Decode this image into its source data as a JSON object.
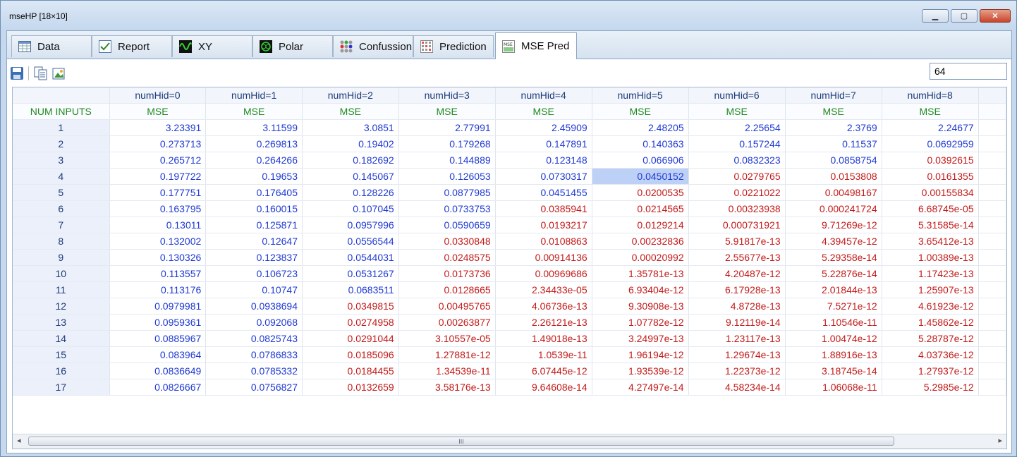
{
  "window": {
    "title": "mseHP [18×10]"
  },
  "tabs": [
    {
      "label": "Data",
      "icon": "table-icon"
    },
    {
      "label": "Report",
      "icon": "checkmark-icon"
    },
    {
      "label": "XY",
      "icon": "waveform-icon"
    },
    {
      "label": "Polar",
      "icon": "polar-icon"
    },
    {
      "label": "Confussion",
      "icon": "dots-grid-icon"
    },
    {
      "label": "Prediction",
      "icon": "grid-icon"
    },
    {
      "label": "MSE Pred",
      "icon": "mse-icon"
    }
  ],
  "active_tab": "MSE Pred",
  "toolbar": {
    "value_input": "64"
  },
  "grid": {
    "corner_header": "",
    "columns": [
      "numHid=0",
      "numHid=1",
      "numHid=2",
      "numHid=3",
      "numHid=4",
      "numHid=5",
      "numHid=6",
      "numHid=7",
      "numHid=8"
    ],
    "row_header_title": "NUM INPUTS",
    "subheader": "MSE",
    "rows": [
      {
        "label": "1",
        "values": [
          "3.23391",
          "3.11599",
          "3.0851",
          "2.77991",
          "2.45909",
          "2.48205",
          "2.25654",
          "2.3769",
          "2.24677"
        ]
      },
      {
        "label": "2",
        "values": [
          "0.273713",
          "0.269813",
          "0.19402",
          "0.179268",
          "0.147891",
          "0.140363",
          "0.157244",
          "0.11537",
          "0.0692959"
        ]
      },
      {
        "label": "3",
        "values": [
          "0.265712",
          "0.264266",
          "0.182692",
          "0.144889",
          "0.123148",
          "0.066906",
          "0.0832323",
          "0.0858754",
          "0.0392615"
        ]
      },
      {
        "label": "4",
        "values": [
          "0.197722",
          "0.19653",
          "0.145067",
          "0.126053",
          "0.0730317",
          "0.0450152",
          "0.0279765",
          "0.0153808",
          "0.0161355"
        ]
      },
      {
        "label": "5",
        "values": [
          "0.177751",
          "0.176405",
          "0.128226",
          "0.0877985",
          "0.0451455",
          "0.0200535",
          "0.0221022",
          "0.00498167",
          "0.00155834"
        ]
      },
      {
        "label": "6",
        "values": [
          "0.163795",
          "0.160015",
          "0.107045",
          "0.0733753",
          "0.0385941",
          "0.0214565",
          "0.00323938",
          "0.000241724",
          "6.68745e-05"
        ]
      },
      {
        "label": "7",
        "values": [
          "0.13011",
          "0.125871",
          "0.0957996",
          "0.0590659",
          "0.0193217",
          "0.0129214",
          "0.000731921",
          "9.71269e-12",
          "5.31585e-14"
        ]
      },
      {
        "label": "8",
        "values": [
          "0.132002",
          "0.12647",
          "0.0556544",
          "0.0330848",
          "0.0108863",
          "0.00232836",
          "5.91817e-13",
          "4.39457e-12",
          "3.65412e-13"
        ]
      },
      {
        "label": "9",
        "values": [
          "0.130326",
          "0.123837",
          "0.0544031",
          "0.0248575",
          "0.00914136",
          "0.00020992",
          "2.55677e-13",
          "5.29358e-14",
          "1.00389e-13"
        ]
      },
      {
        "label": "10",
        "values": [
          "0.113557",
          "0.106723",
          "0.0531267",
          "0.0173736",
          "0.00969686",
          "1.35781e-13",
          "4.20487e-12",
          "5.22876e-14",
          "1.17423e-13"
        ]
      },
      {
        "label": "11",
        "values": [
          "0.113176",
          "0.10747",
          "0.0683511",
          "0.0128665",
          "2.34433e-05",
          "6.93404e-12",
          "6.17928e-13",
          "2.01844e-13",
          "1.25907e-13"
        ]
      },
      {
        "label": "12",
        "values": [
          "0.0979981",
          "0.0938694",
          "0.0349815",
          "0.00495765",
          "4.06736e-13",
          "9.30908e-13",
          "4.8728e-13",
          "7.5271e-12",
          "4.61923e-12"
        ]
      },
      {
        "label": "13",
        "values": [
          "0.0959361",
          "0.092068",
          "0.0274958",
          "0.00263877",
          "2.26121e-13",
          "1.07782e-12",
          "9.12119e-14",
          "1.10546e-11",
          "1.45862e-12"
        ]
      },
      {
        "label": "14",
        "values": [
          "0.0885967",
          "0.0825743",
          "0.0291044",
          "3.10557e-05",
          "1.49018e-13",
          "3.24997e-13",
          "1.23117e-13",
          "1.00474e-12",
          "5.28787e-12"
        ]
      },
      {
        "label": "15",
        "values": [
          "0.083964",
          "0.0786833",
          "0.0185096",
          "1.27881e-12",
          "1.0539e-11",
          "1.96194e-12",
          "1.29674e-13",
          "1.88916e-13",
          "4.03736e-12"
        ]
      },
      {
        "label": "16",
        "values": [
          "0.0836649",
          "0.0785332",
          "0.0184455",
          "1.34539e-11",
          "6.07445e-12",
          "1.93539e-12",
          "1.22373e-12",
          "3.18745e-14",
          "1.27937e-12"
        ]
      },
      {
        "label": "17",
        "values": [
          "0.0826667",
          "0.0756827",
          "0.0132659",
          "3.58176e-13",
          "9.64608e-14",
          "4.27497e-14",
          "4.58234e-14",
          "1.06068e-11",
          "5.2985e-12"
        ]
      }
    ],
    "red_threshold": 0.04,
    "selected_cell": {
      "row": 3,
      "col": 5
    }
  },
  "scrollbar": {
    "thumb_glyph": "III",
    "left_arrow": "◂",
    "right_arrow": "▸"
  },
  "colors": {
    "good": "#1f3ad3",
    "low": "#c31a1a",
    "header": "#1d3a78",
    "mse": "#1f8a1f"
  }
}
